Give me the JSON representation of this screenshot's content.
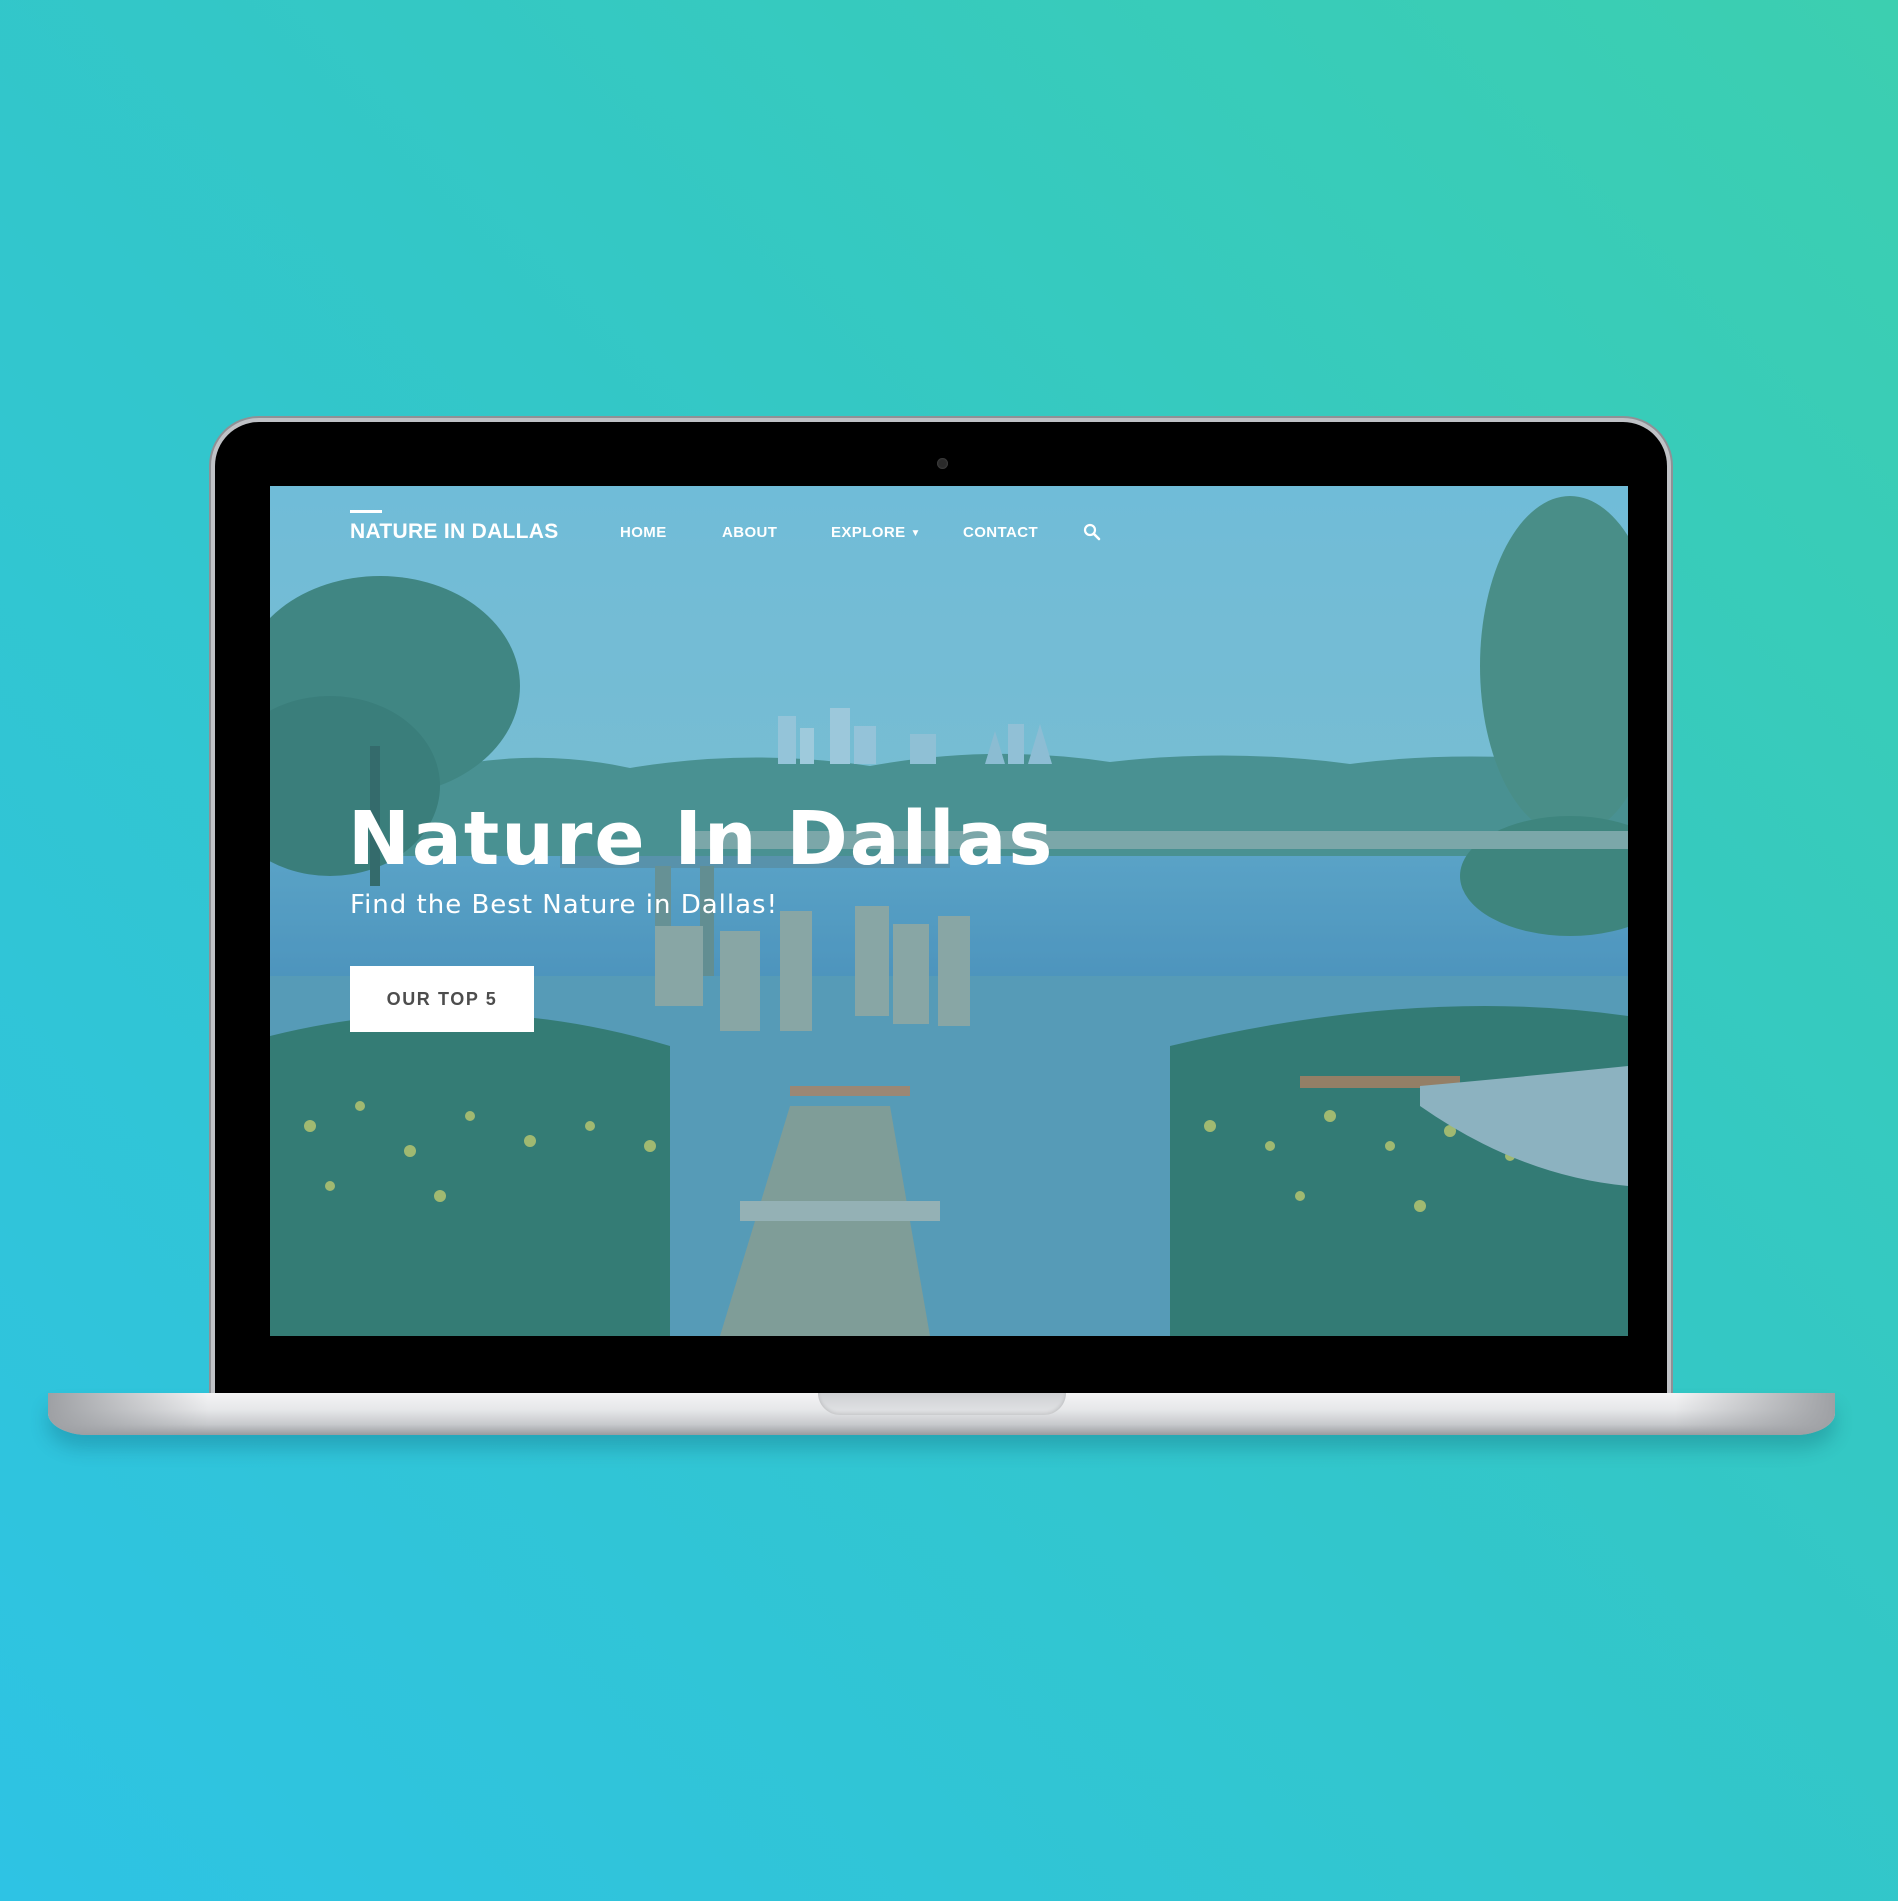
{
  "site": {
    "brand": "NATURE IN DALLAS",
    "nav": {
      "home": "HOME",
      "about": "ABOUT",
      "explore": "EXPLORE",
      "contact": "CONTACT"
    },
    "icons": {
      "search": "search-icon",
      "explore_dropdown": "chevron-down-icon"
    }
  },
  "hero": {
    "title": "Nature In Dallas",
    "subtitle": "Find the Best Nature in Dallas!",
    "cta_label": "OUR TOP 5"
  },
  "colors": {
    "background_start": "#3ccfb0",
    "background_end": "#2ec3e4",
    "overlay": "#48a0be",
    "button_bg": "#ffffff",
    "button_text": "#4d4d4d"
  }
}
